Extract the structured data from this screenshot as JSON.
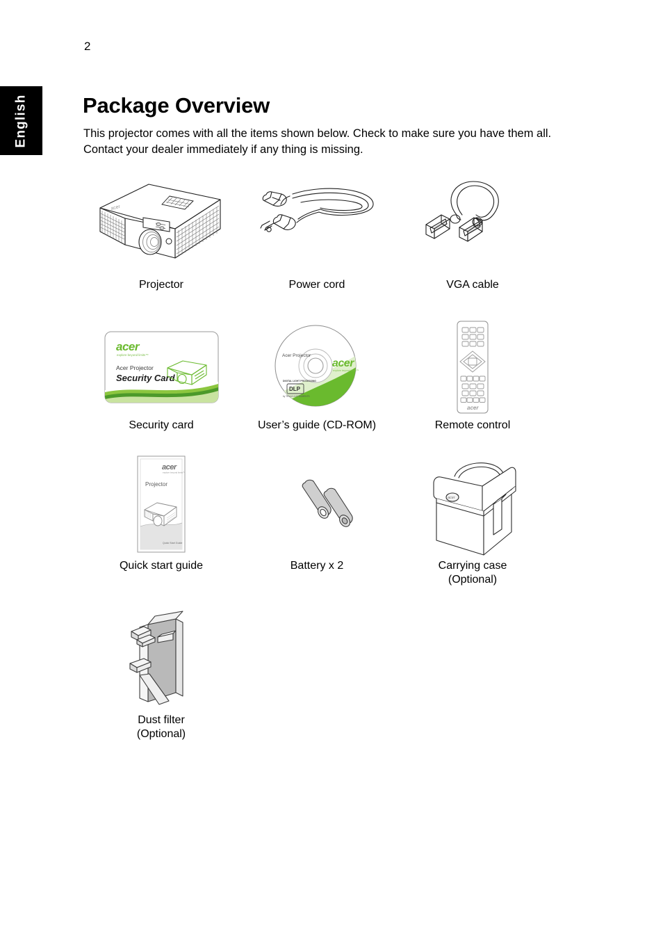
{
  "page": {
    "number": "2",
    "language_tab": "English",
    "title": "Package Overview",
    "intro": "This projector comes with all the items shown below. Check to make sure you have them all. Contact your dealer immediately if any thing is missing."
  },
  "colors": {
    "tab_background": "#000000",
    "tab_text": "#ffffff",
    "text": "#000000",
    "acer_green": "#6aba2e",
    "line_art": "#222222",
    "grey_fill": "#c8c8c8"
  },
  "items": [
    [
      {
        "label": "Projector",
        "icon": "projector-illustration"
      },
      {
        "label": "Power cord",
        "icon": "power-cord-illustration"
      },
      {
        "label": "VGA cable",
        "icon": "vga-cable-illustration"
      }
    ],
    [
      {
        "label": "Security card",
        "icon": "security-card-illustration"
      },
      {
        "label": "User’s guide (CD-ROM)",
        "icon": "cd-rom-illustration"
      },
      {
        "label": "Remote control",
        "icon": "remote-control-illustration"
      }
    ],
    [
      {
        "label": "Quick start guide",
        "icon": "quick-start-guide-illustration"
      },
      {
        "label": "Battery x 2",
        "icon": "battery-illustration"
      },
      {
        "label": "Carrying case\n(Optional)",
        "icon": "carrying-case-illustration"
      }
    ],
    [
      {
        "label": "Dust filter\n(Optional)",
        "icon": "dust-filter-illustration"
      }
    ]
  ],
  "artwork_text": {
    "security_card": {
      "brand": "acer",
      "tagline": "explore beyond limits™",
      "line1": "Acer Projector",
      "line2": "Security Card"
    },
    "cd_rom": {
      "title": "Acer Projector",
      "brand": "acer",
      "tagline": "explore beyond limits™",
      "badge_top": "DIGITAL LIGHT PROCESSING",
      "badge_main": "DLP",
      "badge_sub": "by TEXAS INSTRUMENTS"
    },
    "remote_control": {
      "brand": "acer"
    },
    "quick_start_guide": {
      "brand": "acer",
      "tagline": "explore beyond limits™",
      "title": "Projector",
      "footer": "Quick Start Guide"
    }
  }
}
